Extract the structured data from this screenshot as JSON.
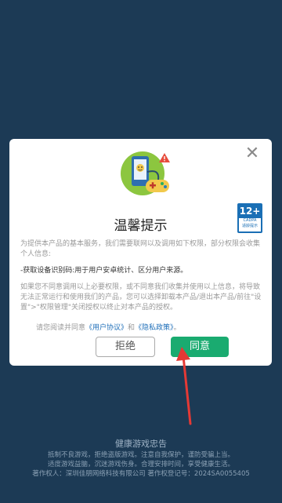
{
  "dialog": {
    "title": "温馨提示",
    "paragraph1": "为提供本产品的基本服务，我们需要联网以及调用如下权限，部分权限会收集个人信息:",
    "paragraph2_label": "-获取设备识别码:",
    "paragraph2_rest": "用于用户安卓统计、区分用户来源。",
    "paragraph3": "如果您不同意调用以上必要权限，或不同意我们收集并使用以上信息，将导致无法正常运行和使用我们的产品，您可以选择卸载本产品/退出本产品/前往\"设置\">\"权限管理\"关闭授权以终止对本产品的授权。",
    "read_prefix": "请您阅读并同意",
    "user_agreement": "《用户协议》",
    "and": "和",
    "privacy_policy": "《隐私政策》",
    "period": "。",
    "reject_label": "拒绝",
    "agree_label": "同意",
    "age_rating": "12+",
    "age_cadpa": "CADPA",
    "age_text": "适龄提示"
  },
  "footer": {
    "title": "健康游戏忠告",
    "line1": "抵制不良游戏，拒绝盗版游戏。注意自我保护，谨防受骗上当。",
    "line2": "适度游戏益脑，沉迷游戏伤身。合理安排时间，享受健康生活。",
    "line3": "著作权人：深圳佳朋网络科技有限公司    著作权登记号：2024SA0055405"
  },
  "colors": {
    "background": "#1c3a55",
    "agree": "#1aab70",
    "link": "#1f6fb9",
    "arrow": "#e53935"
  }
}
